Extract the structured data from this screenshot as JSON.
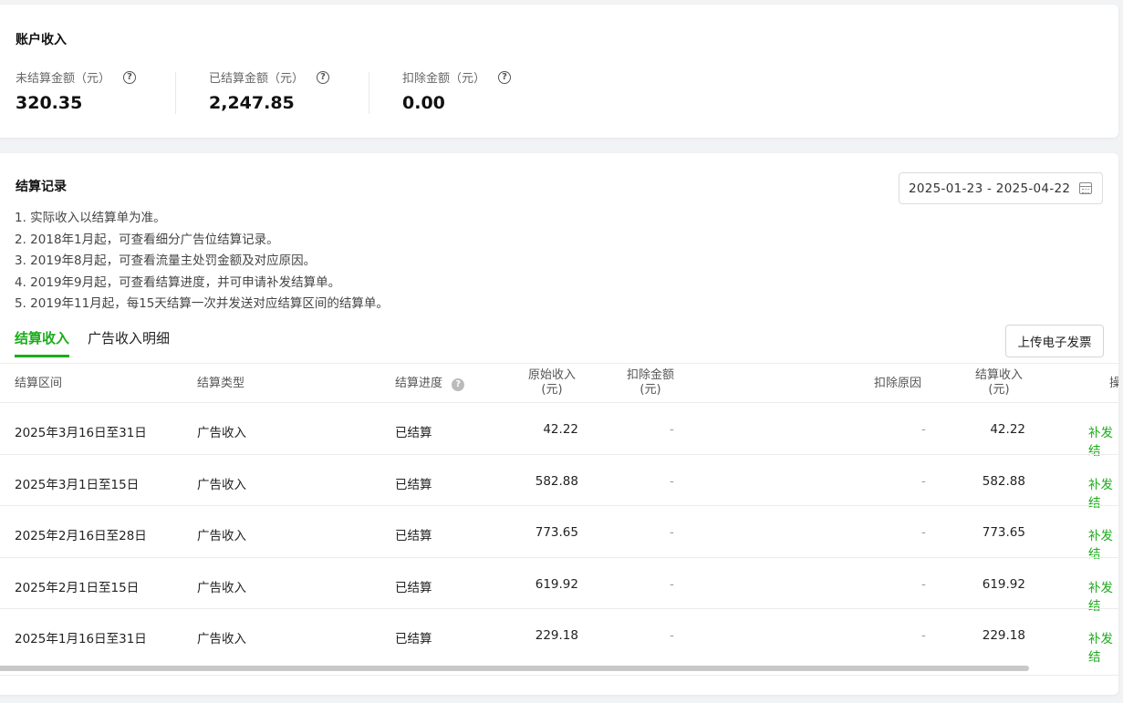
{
  "account": {
    "title": "账户收入",
    "stats": [
      {
        "label": "未结算金额（元）",
        "value": "320.35"
      },
      {
        "label": "已结算金额（元）",
        "value": "2,247.85"
      },
      {
        "label": "扣除金额（元）",
        "value": "0.00"
      }
    ]
  },
  "records": {
    "title": "结算记录",
    "date_range": "2025-01-23 - 2025-04-22",
    "notes": [
      "1. 实际收入以结算单为准。",
      "2. 2018年1月起，可查看细分广告位结算记录。",
      "3. 2019年8月起，可查看流量主处罚金额及对应原因。",
      "4. 2019年9月起，可查看结算进度，并可申请补发结算单。",
      "5. 2019年11月起，每15天结算一次并发送对应结算区间的结算单。"
    ],
    "tabs": [
      "结算收入",
      "广告收入明细"
    ],
    "upload_button": "上传电子发票",
    "columns": {
      "period": "结算区间",
      "type": "结算类型",
      "progress": "结算进度",
      "original": "原始收入\n(元)",
      "deduct": "扣除金额\n(元)",
      "reason": "扣除原因",
      "income": "结算收入\n(元)",
      "action": "操"
    },
    "rows": [
      {
        "period": "2025年3月16日至31日",
        "type": "广告收入",
        "progress": "已结算",
        "original": "42.22",
        "deduct": "-",
        "reason": "-",
        "income": "42.22",
        "action": "补发结"
      },
      {
        "period": "2025年3月1日至15日",
        "type": "广告收入",
        "progress": "已结算",
        "original": "582.88",
        "deduct": "-",
        "reason": "-",
        "income": "582.88",
        "action": "补发结"
      },
      {
        "period": "2025年2月16日至28日",
        "type": "广告收入",
        "progress": "已结算",
        "original": "773.65",
        "deduct": "-",
        "reason": "-",
        "income": "773.65",
        "action": "补发结"
      },
      {
        "period": "2025年2月1日至15日",
        "type": "广告收入",
        "progress": "已结算",
        "original": "619.92",
        "deduct": "-",
        "reason": "-",
        "income": "619.92",
        "action": "补发结"
      },
      {
        "period": "2025年1月16日至31日",
        "type": "广告收入",
        "progress": "已结算",
        "original": "229.18",
        "deduct": "-",
        "reason": "-",
        "income": "229.18",
        "action": "补发结"
      }
    ]
  }
}
